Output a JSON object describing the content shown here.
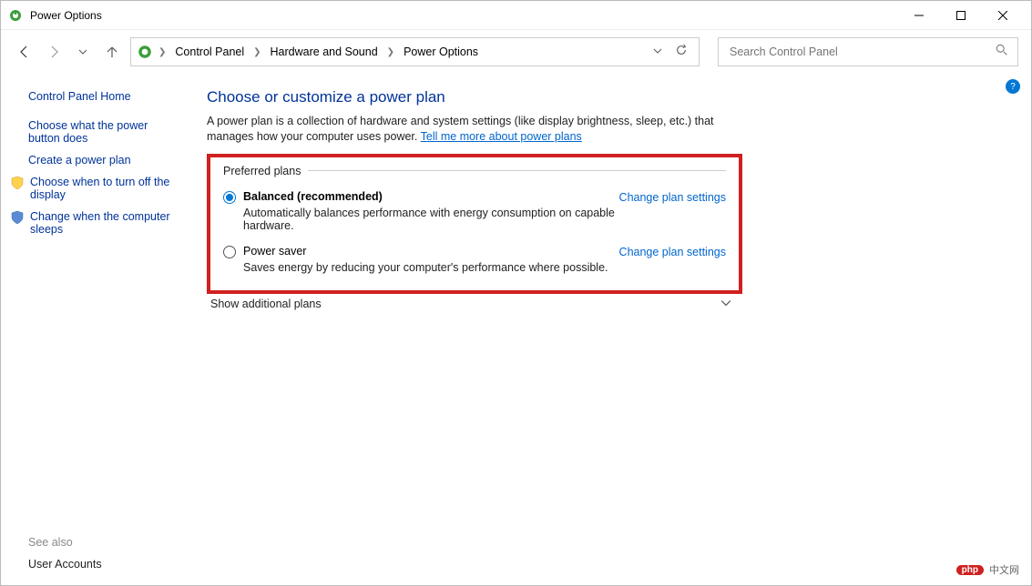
{
  "window": {
    "title": "Power Options"
  },
  "breadcrumbs": [
    "Control Panel",
    "Hardware and Sound",
    "Power Options"
  ],
  "search": {
    "placeholder": "Search Control Panel"
  },
  "sidebar": {
    "home": "Control Panel Home",
    "links": [
      "Choose what the power button does",
      "Create a power plan",
      "Choose when to turn off the display",
      "Change when the computer sleeps"
    ],
    "see_also_heading": "See also",
    "see_also_link": "User Accounts"
  },
  "main": {
    "heading": "Choose or customize a power plan",
    "description": "A power plan is a collection of hardware and system settings (like display brightness, sleep, etc.) that manages how your computer uses power. ",
    "learn_more": "Tell me more about power plans",
    "section_label": "Preferred plans",
    "plans": [
      {
        "name": "Balanced (recommended)",
        "desc": "Automatically balances performance with energy consumption on capable hardware.",
        "change": "Change plan settings",
        "selected": true
      },
      {
        "name": "Power saver",
        "desc": "Saves energy by reducing your computer's performance where possible.",
        "change": "Change plan settings",
        "selected": false
      }
    ],
    "show_more": "Show additional plans"
  },
  "watermark": {
    "badge": "php",
    "text": "中文网"
  }
}
